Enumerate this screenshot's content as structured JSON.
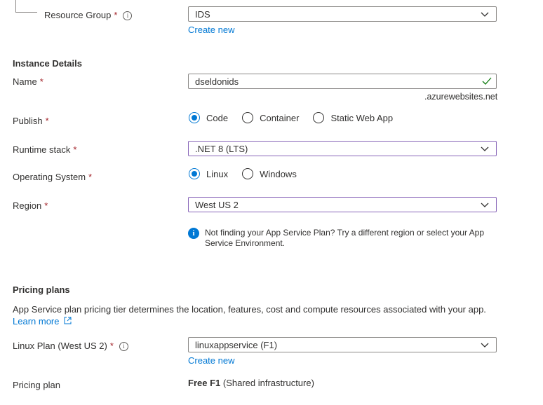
{
  "project": {
    "resource_group_label": "Resource Group",
    "resource_group_value": "IDS",
    "create_new": "Create new"
  },
  "instance": {
    "title": "Instance Details",
    "name_label": "Name",
    "name_value": "dseldonids",
    "name_suffix": ".azurewebsites.net",
    "publish_label": "Publish",
    "publish_options": [
      "Code",
      "Container",
      "Static Web App"
    ],
    "publish_selected": "Code",
    "runtime_label": "Runtime stack",
    "runtime_value": ".NET 8 (LTS)",
    "os_label": "Operating System",
    "os_options": [
      "Linux",
      "Windows"
    ],
    "os_selected": "Linux",
    "region_label": "Region",
    "region_value": "West US 2",
    "region_info": "Not finding your App Service Plan? Try a different region or select your App Service Environment."
  },
  "pricing": {
    "title": "Pricing plans",
    "description": "App Service plan pricing tier determines the location, features, cost and compute resources associated with your app.",
    "learn_more": "Learn more",
    "plan_label": "Linux Plan (West US 2)",
    "plan_value": "linuxappservice (F1)",
    "create_new": "Create new",
    "pricing_plan_label": "Pricing plan",
    "pricing_plan_name": "Free F1",
    "pricing_plan_detail": "(Shared infrastructure)"
  },
  "required_marker": "*",
  "colors": {
    "accent": "#0078d4",
    "focus": "#8764b8",
    "success": "#107c10",
    "required": "#a4262c"
  }
}
